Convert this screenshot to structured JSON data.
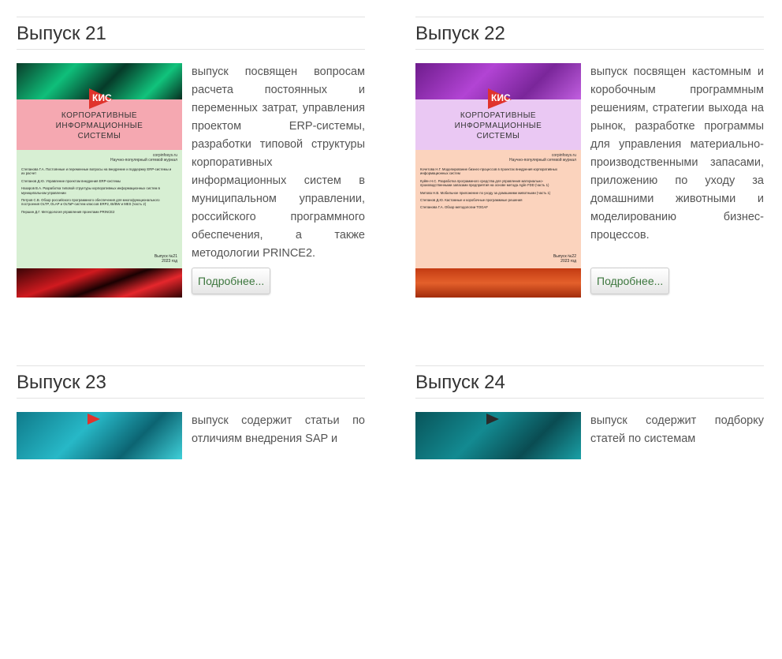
{
  "more_label": "Подробнее...",
  "issues": [
    {
      "title": "Выпуск 21",
      "description": "выпуск посвящен вопросам расчета постоянных и переменных затрат, управления проектом ERP-системы, разработки типовой структуры корпоративных информационных систем в муниципальном управлении, российского программного обеспечения, а также методологии PRINCE2.",
      "cover": {
        "logo": "КИС",
        "title_lines": [
          "КОРПОРАТИВНЫЕ",
          "ИНФОРМАЦИОННЫЕ",
          "СИСТЕМЫ"
        ],
        "site": "corpinfosys.ru",
        "tagline": "Научно-популярный сетевой журнал",
        "articles": [
          "Степанова Г.А. Постоянные и переменные вопросы на внедрение и поддержку ERP-системы и их расчет",
          "Степанов Д.Ю. Управление проектом внедрения ERP-системы",
          "Назаров В.А. Разработка типовой структуры корпоративных информационных систем в муниципальном управлении",
          "Петров С.В. Обзор российского программного обеспечения для многофункционального построения OLTP, OLAP и OLTaP-систем классов ERP2, BI/BW и MES (часть 2)",
          "Першин Д.Г. Методология управления проектами PRINCE2"
        ],
        "issue_no": "Выпуск №21",
        "year": "2023 год"
      }
    },
    {
      "title": "Выпуск 22",
      "description": "выпуск посвящен кастомным и коробочным программным решениям, стратегии выхода на рынок, разработке программы для управления материально-производственными запасами, приложению по уходу за домашними животными и моделированию бизнес-процессов.",
      "cover": {
        "logo": "КИС",
        "title_lines": [
          "КОРПОРАТИВНЫЕ",
          "ИНФОРМАЦИОННЫЕ",
          "СИСТЕМЫ"
        ],
        "site": "corpinfosys.ru",
        "tagline": "Научно-популярный сетевой журнал",
        "articles": [
          "Кочетова Н.Г. Моделирование бизнес-процессов в проектах внедрения корпоративных информационных систем",
          "Куйян Н.С. Разработка программного средства для управления материально-производственными запасами предприятия на основе метода Agile FDD (часть 1)",
          "Митова Н.В. Мобильное приложение по уходу за домашними животными (часть 1)",
          "Степанов Д.Ю. Кастомные и коробочные программные решения",
          "Степанова Г.А. Обзор методологии TOGAF"
        ],
        "issue_no": "Выпуск №22",
        "year": "2023 год"
      }
    },
    {
      "title": "Выпуск 23",
      "description": "выпуск содержит статьи по отличиям внедрения SAP и"
    },
    {
      "title": "Выпуск 24",
      "description": "выпуск содержит подборку статей по системам"
    }
  ],
  "colors": {
    "title_text": "#333333",
    "description_text": "#555555",
    "divider": "#e2e2e2",
    "button_text": "#3c763d"
  }
}
